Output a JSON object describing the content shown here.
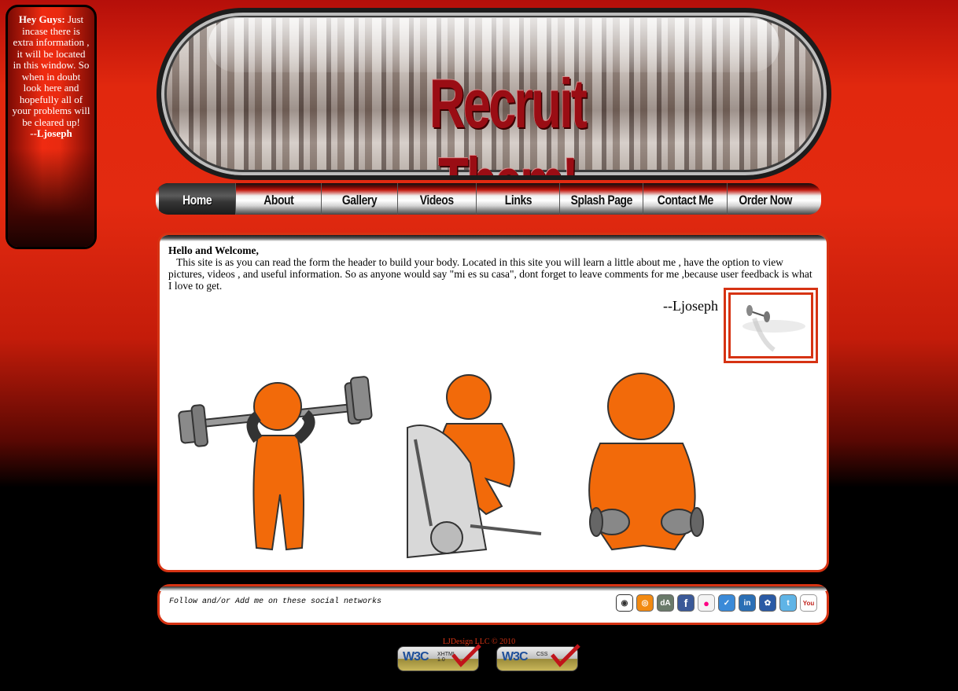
{
  "sidebar_note": {
    "heading": "Hey Guys:",
    "body": " Just incase there is extra information , it will be located in this window. So when in doubt look here and hopefully all of your problems will be cleared up!",
    "signature": "--Ljoseph"
  },
  "banner": {
    "title": "Recruit Them!"
  },
  "nav": {
    "items": [
      {
        "label": "Home",
        "active": true
      },
      {
        "label": "About"
      },
      {
        "label": "Gallery"
      },
      {
        "label": "Videos"
      },
      {
        "label": "Links"
      },
      {
        "label": "Splash Page"
      },
      {
        "label": "Contact Me"
      },
      {
        "label": "Order Now"
      }
    ]
  },
  "content": {
    "greeting": "Hello and Welcome,",
    "paragraph": "This site is as you can read the form the header to build your body. Located in this site you will learn a little about me , have the option to view pictures, videos , and useful information. So as anyone would say \"mi es su casa\", dont forget to leave comments for me ,because user feedback is what I love to get.",
    "signature": "--Ljoseph"
  },
  "social": {
    "text": "Follow and/or Add me on these social networks",
    "icons": [
      "camera-icon",
      "rss-icon",
      "deviantart-icon",
      "facebook-icon",
      "flickr-icon",
      "delicious-icon",
      "linkedin-icon",
      "myspace-icon",
      "twitter-icon",
      "youtube-icon"
    ]
  },
  "footer": {
    "copyright": "LJDesign LLC © 2010",
    "badges": [
      {
        "w3": "W3C",
        "kind_line1": "XHTML",
        "kind_line2": "1.0"
      },
      {
        "w3": "W3C",
        "kind_line1": "CSS",
        "kind_line2": ""
      }
    ]
  },
  "colors": {
    "accent": "#d63313",
    "banner_title": "#9a0d14",
    "figure": "#f26a0a"
  }
}
